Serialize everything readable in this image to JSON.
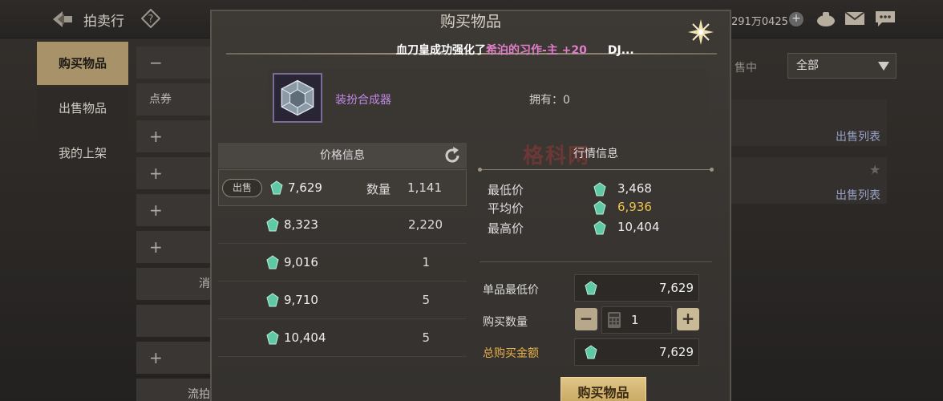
{
  "header": {
    "title": "拍卖行",
    "currency": "291万0425"
  },
  "sidebar": {
    "items": [
      {
        "label": "购买物品",
        "active": true
      },
      {
        "label": "出售物品",
        "active": false
      },
      {
        "label": "我的上架",
        "active": false
      }
    ]
  },
  "midlist": {
    "search_value": "点券",
    "partial_labels": [
      "消",
      "流拍"
    ]
  },
  "right_panel": {
    "filter_label": "售中",
    "filter_selected": "全部",
    "row_links": [
      "出售列表",
      "出售列表"
    ]
  },
  "dialog": {
    "title": "购买物品",
    "marquee": {
      "prefix": "血刀皇成功强化了",
      "highlight": "希泊的习作-主 +20",
      "tail": "DJ..."
    },
    "item": {
      "name": "装扮合成器",
      "owned_label": "拥有：",
      "owned_value": "0"
    },
    "price_panel": {
      "header": "价格信息",
      "sell_badge": "出售",
      "qty_label": "数量",
      "rows": [
        {
          "price": "7,629",
          "qty": "1,141"
        },
        {
          "price": "8,323",
          "qty": "2,220"
        },
        {
          "price": "9,016",
          "qty": "1"
        },
        {
          "price": "9,710",
          "qty": "5"
        },
        {
          "price": "10,404",
          "qty": "5"
        }
      ]
    },
    "market_panel": {
      "header": "行情信息",
      "watermark": "格科网",
      "rows": [
        {
          "label": "最低价",
          "value": "3,468"
        },
        {
          "label": "平均价",
          "value": "6,936"
        },
        {
          "label": "最高价",
          "value": "10,404"
        }
      ]
    },
    "purchase": {
      "unit_min_label": "单品最低价",
      "unit_min_value": "7,629",
      "qty_label": "购买数量",
      "qty_value": "1",
      "total_label": "总购买金额",
      "total_value": "7,629",
      "buy_button": "购买物品"
    }
  },
  "colors": {
    "accent_gold": "#e8b34a",
    "item_purple": "#c089e6",
    "gem": "#5fc9a6"
  }
}
